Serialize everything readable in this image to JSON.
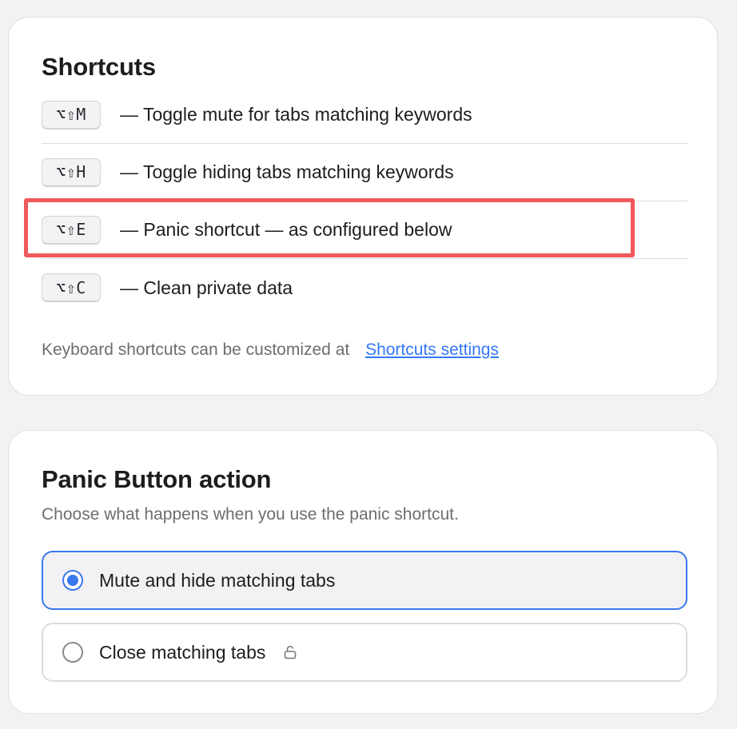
{
  "shortcuts": {
    "title": "Shortcuts",
    "items": [
      {
        "keys": "⌥⇧M",
        "description": "— Toggle mute for tabs matching keywords"
      },
      {
        "keys": "⌥⇧H",
        "description": "— Toggle hiding tabs matching keywords"
      },
      {
        "keys": "⌥⇧E",
        "description": "— Panic shortcut — as configured below"
      },
      {
        "keys": "⌥⇧C",
        "description": "— Clean private data"
      }
    ],
    "footnote": "Keyboard shortcuts can be customized at",
    "settings_link": "Shortcuts settings",
    "highlight_color": "#f0585b"
  },
  "panic": {
    "title": "Panic Button action",
    "subtitle": "Choose what happens when you use the panic shortcut.",
    "options": [
      {
        "label": "Mute and hide matching tabs",
        "selected": true
      },
      {
        "label": "Close matching tabs",
        "selected": false,
        "icon": "lock-open-icon"
      }
    ],
    "accent_color": "#3a78ee"
  }
}
